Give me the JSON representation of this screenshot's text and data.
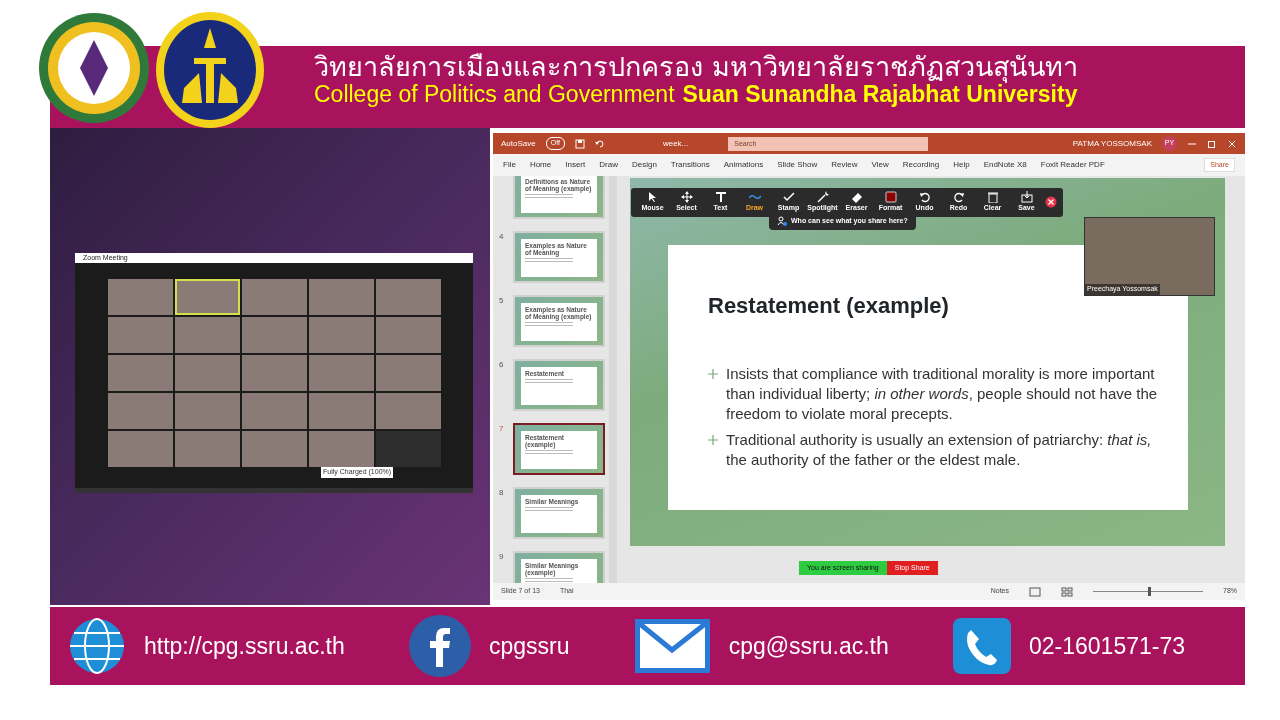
{
  "header": {
    "thai_title": "วิทยาลัยการเมืองและการปกครอง มหาวิทยาลัยราชภัฏสวนสุนันทา",
    "english_title": [
      "College of Politics and Government",
      "Suan Sunandha Rajabhat University"
    ]
  },
  "zoom_window": {
    "title": "Zoom Meeting",
    "tooltip": "Fully Charged (100%)",
    "tiles": [
      {
        "video": true,
        "highlighted": false
      },
      {
        "video": true,
        "highlighted": true
      },
      {
        "video": true,
        "highlighted": false
      },
      {
        "video": true,
        "highlighted": false
      },
      {
        "video": true,
        "highlighted": false
      },
      {
        "video": true,
        "highlighted": false
      },
      {
        "video": true,
        "highlighted": false
      },
      {
        "video": true,
        "highlighted": false
      },
      {
        "video": true,
        "highlighted": false
      },
      {
        "video": true,
        "highlighted": false
      },
      {
        "video": true,
        "highlighted": false
      },
      {
        "video": true,
        "highlighted": false
      },
      {
        "video": true,
        "highlighted": false
      },
      {
        "video": true,
        "highlighted": false
      },
      {
        "video": true,
        "highlighted": false
      },
      {
        "video": true,
        "highlighted": false
      },
      {
        "video": true,
        "highlighted": false
      },
      {
        "video": true,
        "highlighted": false
      },
      {
        "video": true,
        "highlighted": false
      },
      {
        "video": true,
        "highlighted": false
      },
      {
        "video": true,
        "highlighted": false
      },
      {
        "video": true,
        "highlighted": false
      },
      {
        "video": true,
        "highlighted": false
      },
      {
        "video": true,
        "highlighted": false
      },
      {
        "video": false,
        "highlighted": false
      }
    ]
  },
  "powerpoint": {
    "title_bar": {
      "autosave_label": "AutoSave",
      "autosave": {
        "label": "Off",
        "on": false
      },
      "file_name": "week...",
      "search_placeholder": "Search",
      "user_name": "PATMA YOSSOMSAK",
      "user_initials": "PY"
    },
    "ribbon_tabs": [
      "File",
      "Home",
      "Insert",
      "Draw",
      "Design",
      "Transitions",
      "Animations",
      "Slide Show",
      "Review",
      "View",
      "Recording",
      "Help",
      "EndNote X8",
      "Foxit Reader PDF"
    ],
    "share_button": "Share",
    "thumbnails": [
      {
        "title": "Definitions as Nature of Meaning (example)",
        "selected": false
      },
      {
        "number": "4",
        "title": "Examples as Nature of Meaning",
        "selected": false
      },
      {
        "number": "5",
        "title": "Examples as Nature of Meaning (example)",
        "selected": false
      },
      {
        "number": "6",
        "title": "Restatement",
        "selected": false
      },
      {
        "number": "7",
        "title": "Restatement (example)",
        "selected": true
      },
      {
        "number": "8",
        "title": "Similar Meanings",
        "selected": false
      },
      {
        "number": "9",
        "title": "Similar Meanings (example)",
        "selected": false
      }
    ],
    "slide": {
      "title": "Restatement (example)",
      "bullets": [
        "Insists that compliance with traditional morality is more important than individual liberty; *in other words*, people should not have the freedom to violate moral precepts.",
        "Traditional authority is usually an extension of patriarchy: *that is,* the authority of the father or the eldest male."
      ]
    },
    "zoom_toolbar": {
      "tools": [
        {
          "label": "Mouse",
          "selected": false
        },
        {
          "label": "Select",
          "selected": false
        },
        {
          "label": "Text",
          "selected": false
        },
        {
          "label": "Draw",
          "selected": true
        },
        {
          "label": "Stamp",
          "selected": false
        },
        {
          "label": "Spotlight",
          "selected": false
        },
        {
          "label": "Eraser",
          "selected": false
        },
        {
          "label": "Format",
          "selected": false
        },
        {
          "label": "Undo",
          "selected": false
        },
        {
          "label": "Redo",
          "selected": false
        },
        {
          "label": "Clear",
          "selected": false
        },
        {
          "label": "Save",
          "selected": false
        }
      ],
      "notice": "Who can see what you share here?"
    },
    "video": {
      "name": "Preechaya Yossomsak"
    },
    "sharing_bar": {
      "message": "You are screen sharing",
      "stop_button": "Stop Share"
    },
    "status_bar": {
      "slide_info": "Slide 7 of 13",
      "language": "Thai",
      "notes": "Notes",
      "zoom": {
        "level": 0.5,
        "reading": "78%"
      }
    }
  },
  "footer": {
    "items": [
      {
        "kind": "web",
        "text": "http://cpg.ssru.ac.th"
      },
      {
        "kind": "facebook",
        "text": "cpgssru"
      },
      {
        "kind": "mail",
        "text": "cpg@ssru.ac.th"
      },
      {
        "kind": "phone",
        "text": "02-1601571-73"
      }
    ]
  }
}
